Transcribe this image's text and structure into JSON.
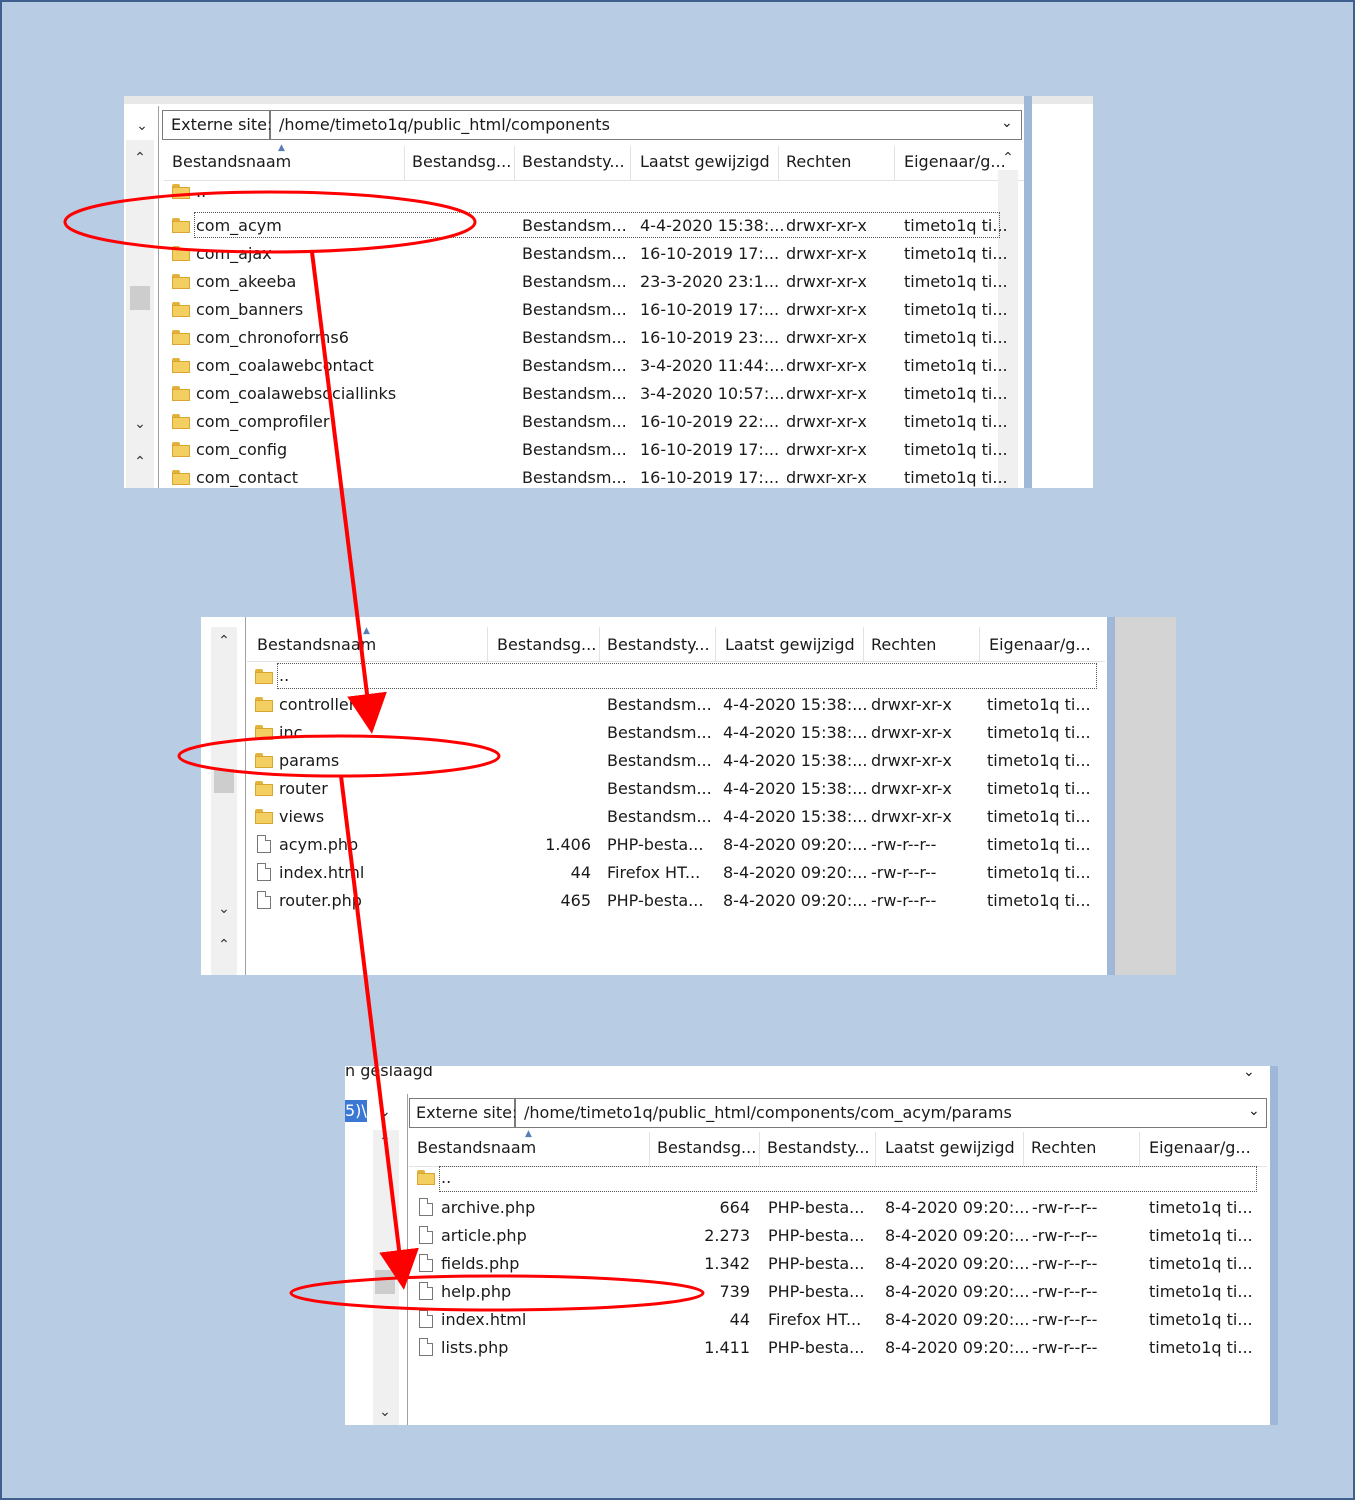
{
  "panel1": {
    "path_label": "Externe site:",
    "path_value": "/home/timeto1q/public_html/components",
    "columns": [
      "Bestandsnaam",
      "Bestandsg...",
      "Bestandsty...",
      "Laatst gewijzigd",
      "Rechten",
      "Eigenaar/g..."
    ],
    "parent": "..",
    "rows": [
      {
        "name": "com_acym",
        "type": "Bestandsm...",
        "modified": "4-4-2020 15:38:...",
        "perms": "drwxr-xr-x",
        "owner": "timeto1q ti..."
      },
      {
        "name": "com_ajax",
        "type": "Bestandsm...",
        "modified": "16-10-2019 17:...",
        "perms": "drwxr-xr-x",
        "owner": "timeto1q ti..."
      },
      {
        "name": "com_akeeba",
        "type": "Bestandsm...",
        "modified": "23-3-2020 23:1...",
        "perms": "drwxr-xr-x",
        "owner": "timeto1q ti..."
      },
      {
        "name": "com_banners",
        "type": "Bestandsm...",
        "modified": "16-10-2019 17:...",
        "perms": "drwxr-xr-x",
        "owner": "timeto1q ti..."
      },
      {
        "name": "com_chronoforms6",
        "type": "Bestandsm...",
        "modified": "16-10-2019 23:...",
        "perms": "drwxr-xr-x",
        "owner": "timeto1q ti..."
      },
      {
        "name": "com_coalawebcontact",
        "type": "Bestandsm...",
        "modified": "3-4-2020 11:44:...",
        "perms": "drwxr-xr-x",
        "owner": "timeto1q ti..."
      },
      {
        "name": "com_coalawebsociallinks",
        "type": "Bestandsm...",
        "modified": "3-4-2020 10:57:...",
        "perms": "drwxr-xr-x",
        "owner": "timeto1q ti..."
      },
      {
        "name": "com_comprofiler",
        "type": "Bestandsm...",
        "modified": "16-10-2019 22:...",
        "perms": "drwxr-xr-x",
        "owner": "timeto1q ti..."
      },
      {
        "name": "com_config",
        "type": "Bestandsm...",
        "modified": "16-10-2019 17:...",
        "perms": "drwxr-xr-x",
        "owner": "timeto1q ti..."
      },
      {
        "name": "com_contact",
        "type": "Bestandsm...",
        "modified": "16-10-2019 17:...",
        "perms": "drwxr-xr-x",
        "owner": "timeto1q ti..."
      }
    ]
  },
  "panel2": {
    "columns": [
      "Bestandsnaam",
      "Bestandsg...",
      "Bestandsty...",
      "Laatst gewijzigd",
      "Rechten",
      "Eigenaar/g..."
    ],
    "parent": "..",
    "rows": [
      {
        "icon": "folder",
        "name": "controllers",
        "size": "",
        "type": "Bestandsm...",
        "modified": "4-4-2020 15:38:...",
        "perms": "drwxr-xr-x",
        "owner": "timeto1q ti..."
      },
      {
        "icon": "folder",
        "name": "inc",
        "size": "",
        "type": "Bestandsm...",
        "modified": "4-4-2020 15:38:...",
        "perms": "drwxr-xr-x",
        "owner": "timeto1q ti..."
      },
      {
        "icon": "folder",
        "name": "params",
        "size": "",
        "type": "Bestandsm...",
        "modified": "4-4-2020 15:38:...",
        "perms": "drwxr-xr-x",
        "owner": "timeto1q ti..."
      },
      {
        "icon": "folder",
        "name": "router",
        "size": "",
        "type": "Bestandsm...",
        "modified": "4-4-2020 15:38:...",
        "perms": "drwxr-xr-x",
        "owner": "timeto1q ti..."
      },
      {
        "icon": "folder",
        "name": "views",
        "size": "",
        "type": "Bestandsm...",
        "modified": "4-4-2020 15:38:...",
        "perms": "drwxr-xr-x",
        "owner": "timeto1q ti..."
      },
      {
        "icon": "file",
        "name": "acym.php",
        "size": "1.406",
        "type": "PHP-besta...",
        "modified": "8-4-2020 09:20:...",
        "perms": "-rw-r--r--",
        "owner": "timeto1q ti..."
      },
      {
        "icon": "file",
        "name": "index.html",
        "size": "44",
        "type": "Firefox HT...",
        "modified": "8-4-2020 09:20:...",
        "perms": "-rw-r--r--",
        "owner": "timeto1q ti..."
      },
      {
        "icon": "file",
        "name": "router.php",
        "size": "465",
        "type": "PHP-besta...",
        "modified": "8-4-2020 09:20:...",
        "perms": "-rw-r--r--",
        "owner": "timeto1q ti..."
      }
    ]
  },
  "panel3": {
    "status_text": "n geslaagd",
    "left_fragment": "5)\\",
    "path_label": "Externe site:",
    "path_value": "/home/timeto1q/public_html/components/com_acym/params",
    "columns": [
      "Bestandsnaam",
      "Bestandsg...",
      "Bestandsty...",
      "Laatst gewijzigd",
      "Rechten",
      "Eigenaar/g..."
    ],
    "parent": "..",
    "rows": [
      {
        "name": "archive.php",
        "size": "664",
        "type": "PHP-besta...",
        "modified": "8-4-2020 09:20:...",
        "perms": "-rw-r--r--",
        "owner": "timeto1q ti..."
      },
      {
        "name": "article.php",
        "size": "2.273",
        "type": "PHP-besta...",
        "modified": "8-4-2020 09:20:...",
        "perms": "-rw-r--r--",
        "owner": "timeto1q ti..."
      },
      {
        "name": "fields.php",
        "size": "1.342",
        "type": "PHP-besta...",
        "modified": "8-4-2020 09:20:...",
        "perms": "-rw-r--r--",
        "owner": "timeto1q ti..."
      },
      {
        "name": "help.php",
        "size": "739",
        "type": "PHP-besta...",
        "modified": "8-4-2020 09:20:...",
        "perms": "-rw-r--r--",
        "owner": "timeto1q ti..."
      },
      {
        "name": "index.html",
        "size": "44",
        "type": "Firefox HT...",
        "modified": "8-4-2020 09:20:...",
        "perms": "-rw-r--r--",
        "owner": "timeto1q ti..."
      },
      {
        "name": "lists.php",
        "size": "1.411",
        "type": "PHP-besta...",
        "modified": "8-4-2020 09:20:...",
        "perms": "-rw-r--r--",
        "owner": "timeto1q ti..."
      }
    ]
  },
  "annotation": {
    "highlight_color": "#ff0000"
  }
}
